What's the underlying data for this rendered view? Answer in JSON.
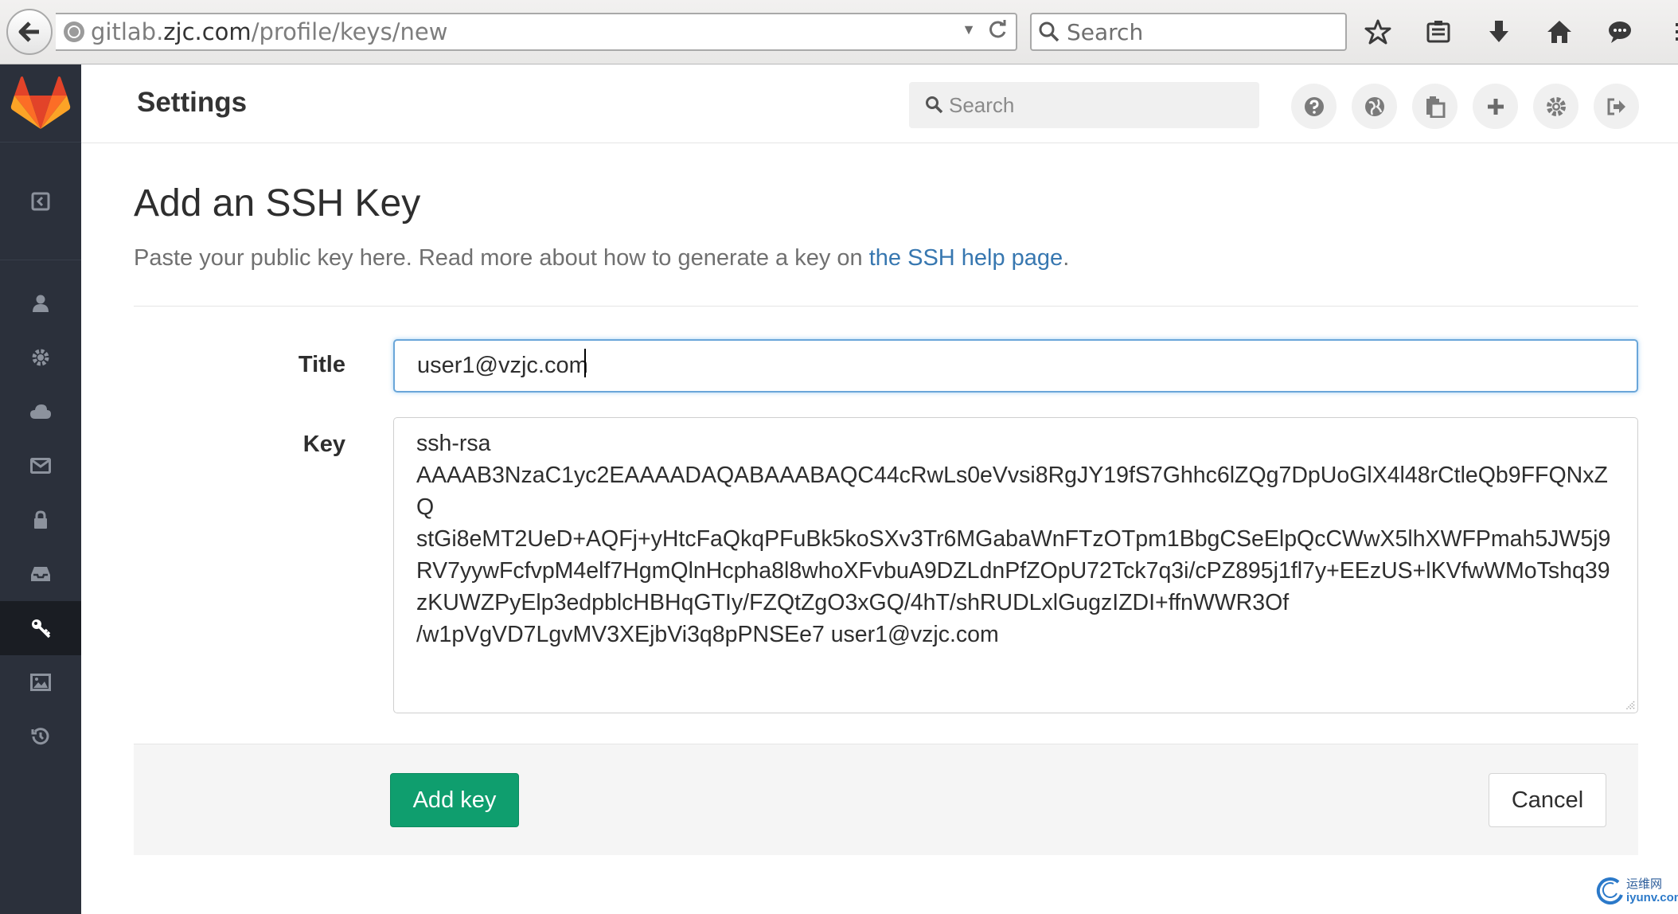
{
  "browser": {
    "url_prefix": "gitlab.",
    "url_domain": "zjc.com",
    "url_path": "/profile/keys/new",
    "search_placeholder": "Search"
  },
  "header": {
    "title": "Settings",
    "search_placeholder": "Search"
  },
  "page": {
    "heading": "Add an SSH Key",
    "lead_text": "Paste your public key here. Read more about how to generate a key on ",
    "lead_link": "the SSH help page",
    "lead_end": "."
  },
  "form": {
    "title_label": "Title",
    "title_value": "user1@vzjc.com",
    "key_label": "Key",
    "key_value": "ssh-rsa\nAAAAB3NzaC1yc2EAAAADAQABAAABAQC44cRwLs0eVvsi8RgJY19fS7Ghhc6lZQg7DpUoGlX4l48rCtleQb9FFQNxZQ\nstGi8eMT2UeD+AQFj+yHtcFaQkqPFuBk5koSXv3Tr6MGabaWnFTzOTpm1BbgCSeElpQcCWwX5lhXWFPmah5JW5j9\nRV7yywFcfvpM4elf7HgmQlnHcpha8l8whoXFvbuA9DZLdnPfZOpU72Tck7q3i/cPZ895j1fl7y+EEzUS+lKVfwWMoTshq39\nzKUWZPyElp3edpblcHBHqGTIy/FZQtZgO3xGQ/4hT/shRUDLxlGugzIZDI+ffnWWR3Of\n/w1pVgVD7LgvMV3XEjbVi3q8pPNSEe7 user1@vzjc.com",
    "add_button": "Add key",
    "cancel_button": "Cancel"
  },
  "watermark": {
    "line1": "运维网",
    "line2": "iyunv.com"
  },
  "colors": {
    "sidebar_bg": "#2b303b",
    "sidebar_active": "#1a1d23",
    "link": "#3777b0",
    "add_button": "#0f9e6e",
    "focus_border": "#6aa6d9"
  }
}
